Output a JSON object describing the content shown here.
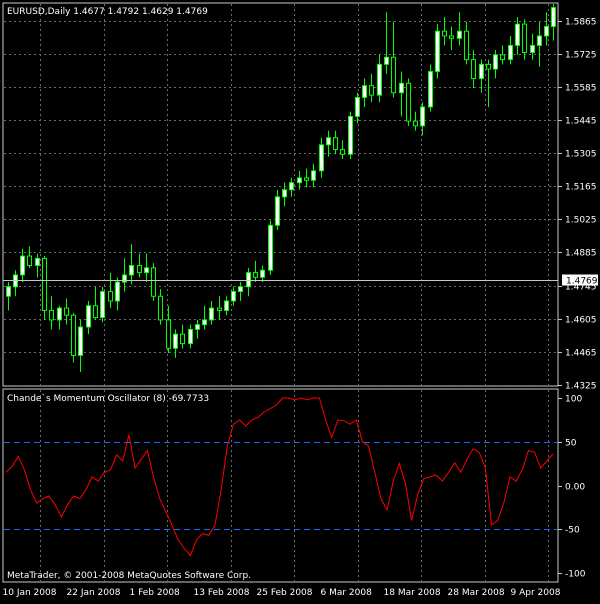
{
  "colors": {
    "background": "#000000",
    "grid": "#6b6b6b",
    "frame": "#c8c8c8",
    "text": "#ffffff",
    "bull_candle": "#ffffff",
    "bear_candle": "#000000",
    "candle_wick": "#00ff00",
    "oscillator_line": "#ff0000",
    "level_line": "#1e64ff",
    "price_marker_bg": "#ffffff",
    "price_marker_text": "#000000"
  },
  "main_panel": {
    "header": "EURUSD,Daily  1.4677 1.4792 1.4629 1.4769",
    "price_marker": "1.4769"
  },
  "indicator_panel": {
    "header": "Chande`s Momentum Oscillator (8) -69.7733"
  },
  "footer": {
    "copyright": "MetaTrader, © 2001-2008 MetaQuotes Software Corp."
  },
  "chart_data": [
    {
      "type": "candlestick",
      "symbol": "EURUSD",
      "timeframe": "Daily",
      "current_ohlc": {
        "open": 1.4677,
        "high": 1.4792,
        "low": 1.4629,
        "close": 1.4769
      },
      "price_ticks": [
        "1.5865",
        "1.5725",
        "1.5585",
        "1.5445",
        "1.5305",
        "1.5165",
        "1.5025",
        "1.4885",
        "1.4745",
        "1.4605",
        "1.4465",
        "1.4325"
      ],
      "x_tick_labels": [
        "10 Jan 2008",
        "22 Jan 2008",
        "1 Feb 2008",
        "13 Feb 2008",
        "25 Feb 2008",
        "6 Mar 2008",
        "18 Mar 2008",
        "28 Mar 2008",
        "9 Apr 2008"
      ],
      "ylim": [
        1.4325,
        1.5935
      ],
      "candles": [
        [
          1.47,
          1.476,
          1.464,
          1.474
        ],
        [
          1.474,
          1.481,
          1.47,
          1.479
        ],
        [
          1.479,
          1.49,
          1.476,
          1.487
        ],
        [
          1.487,
          1.491,
          1.482,
          1.483
        ],
        [
          1.483,
          1.488,
          1.478,
          1.486
        ],
        [
          1.486,
          1.487,
          1.46,
          1.464
        ],
        [
          1.464,
          1.47,
          1.456,
          1.46
        ],
        [
          1.46,
          1.466,
          1.456,
          1.465
        ],
        [
          1.465,
          1.469,
          1.458,
          1.462
        ],
        [
          1.462,
          1.463,
          1.442,
          1.445
        ],
        [
          1.445,
          1.46,
          1.438,
          1.457
        ],
        [
          1.457,
          1.468,
          1.454,
          1.466
        ],
        [
          1.466,
          1.474,
          1.46,
          1.461
        ],
        [
          1.461,
          1.474,
          1.459,
          1.472
        ],
        [
          1.472,
          1.48,
          1.465,
          1.468
        ],
        [
          1.468,
          1.478,
          1.464,
          1.476
        ],
        [
          1.476,
          1.486,
          1.472,
          1.479
        ],
        [
          1.479,
          1.492,
          1.475,
          1.483
        ],
        [
          1.483,
          1.488,
          1.478,
          1.48
        ],
        [
          1.48,
          1.488,
          1.476,
          1.482
        ],
        [
          1.482,
          1.484,
          1.468,
          1.47
        ],
        [
          1.47,
          1.473,
          1.458,
          1.46
        ],
        [
          1.46,
          1.466,
          1.446,
          1.448
        ],
        [
          1.448,
          1.456,
          1.444,
          1.454
        ],
        [
          1.454,
          1.458,
          1.448,
          1.45
        ],
        [
          1.45,
          1.458,
          1.448,
          1.456
        ],
        [
          1.456,
          1.46,
          1.452,
          1.458
        ],
        [
          1.458,
          1.466,
          1.456,
          1.46
        ],
        [
          1.46,
          1.468,
          1.458,
          1.465
        ],
        [
          1.465,
          1.47,
          1.46,
          1.464
        ],
        [
          1.464,
          1.47,
          1.462,
          1.468
        ],
        [
          1.468,
          1.474,
          1.466,
          1.472
        ],
        [
          1.472,
          1.476,
          1.468,
          1.474
        ],
        [
          1.474,
          1.482,
          1.47,
          1.48
        ],
        [
          1.48,
          1.485,
          1.476,
          1.478
        ],
        [
          1.478,
          1.483,
          1.476,
          1.481
        ],
        [
          1.481,
          1.502,
          1.479,
          1.5
        ],
        [
          1.5,
          1.515,
          1.498,
          1.512
        ],
        [
          1.512,
          1.518,
          1.508,
          1.515
        ],
        [
          1.515,
          1.52,
          1.512,
          1.518
        ],
        [
          1.518,
          1.523,
          1.515,
          1.52
        ],
        [
          1.52,
          1.524,
          1.516,
          1.519
        ],
        [
          1.519,
          1.526,
          1.516,
          1.523
        ],
        [
          1.523,
          1.537,
          1.52,
          1.534
        ],
        [
          1.534,
          1.54,
          1.529,
          1.537
        ],
        [
          1.537,
          1.54,
          1.53,
          1.532
        ],
        [
          1.532,
          1.536,
          1.528,
          1.53
        ],
        [
          1.53,
          1.548,
          1.528,
          1.546
        ],
        [
          1.546,
          1.556,
          1.543,
          1.554
        ],
        [
          1.554,
          1.562,
          1.55,
          1.559
        ],
        [
          1.559,
          1.564,
          1.552,
          1.555
        ],
        [
          1.555,
          1.572,
          1.552,
          1.568
        ],
        [
          1.568,
          1.59,
          1.564,
          1.571
        ],
        [
          1.571,
          1.586,
          1.554,
          1.556
        ],
        [
          1.556,
          1.565,
          1.546,
          1.56
        ],
        [
          1.56,
          1.562,
          1.542,
          1.544
        ],
        [
          1.544,
          1.548,
          1.54,
          1.542
        ],
        [
          1.542,
          1.552,
          1.538,
          1.55
        ],
        [
          1.55,
          1.568,
          1.548,
          1.565
        ],
        [
          1.565,
          1.585,
          1.562,
          1.582
        ],
        [
          1.582,
          1.588,
          1.576,
          1.58
        ],
        [
          1.58,
          1.584,
          1.574,
          1.579
        ],
        [
          1.579,
          1.59,
          1.576,
          1.582
        ],
        [
          1.582,
          1.586,
          1.568,
          1.57
        ],
        [
          1.57,
          1.574,
          1.558,
          1.562
        ],
        [
          1.562,
          1.57,
          1.556,
          1.568
        ],
        [
          1.568,
          1.57,
          1.55,
          1.566
        ],
        [
          1.566,
          1.574,
          1.562,
          1.572
        ],
        [
          1.572,
          1.576,
          1.568,
          1.57
        ],
        [
          1.57,
          1.58,
          1.568,
          1.576
        ],
        [
          1.576,
          1.588,
          1.572,
          1.585
        ],
        [
          1.585,
          1.587,
          1.57,
          1.573
        ],
        [
          1.573,
          1.581,
          1.57,
          1.576
        ],
        [
          1.576,
          1.586,
          1.567,
          1.58
        ],
        [
          1.58,
          1.59,
          1.576,
          1.584
        ],
        [
          1.584,
          1.5935,
          1.578,
          1.592
        ]
      ]
    },
    {
      "type": "line",
      "title": "Chande`s Momentum Oscillator (8) -69.7733",
      "y_ticks": [
        "100",
        "50",
        "0.00",
        "-50",
        "-100"
      ],
      "ylim": [
        -100,
        100
      ],
      "levels": [
        50,
        -50
      ],
      "series": [
        {
          "values": [
            15,
            22,
            33,
            18,
            -5,
            -20,
            -15,
            -12,
            -22,
            -36,
            -22,
            -12,
            -15,
            -5,
            10,
            5,
            15,
            18,
            35,
            28,
            58,
            20,
            30,
            40,
            10,
            -15,
            -30,
            -45,
            -62,
            -72,
            -80,
            -62,
            -55,
            -57,
            -45,
            -5,
            45,
            70,
            75,
            68,
            75,
            78,
            84,
            88,
            92,
            100,
            100,
            98,
            100,
            98,
            100,
            100,
            75,
            55,
            75,
            74,
            70,
            75,
            50,
            45,
            15,
            -15,
            -28,
            5,
            25,
            2,
            -40,
            -10,
            8,
            10,
            12,
            5,
            15,
            26,
            15,
            30,
            42,
            38,
            20,
            -45,
            -40,
            -20,
            10,
            5,
            18,
            40,
            38,
            20,
            28,
            36
          ]
        }
      ]
    }
  ]
}
